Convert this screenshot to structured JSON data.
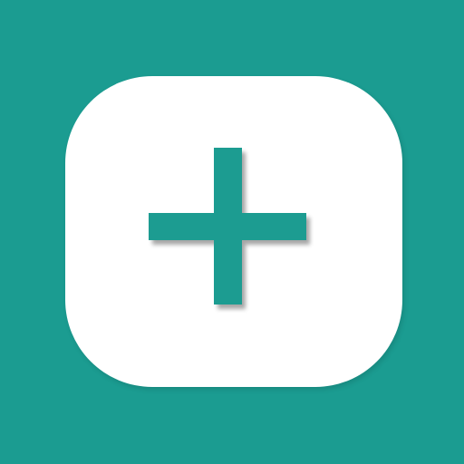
{
  "app": {
    "name": "add",
    "icon": "plus-icon"
  },
  "colors": {
    "background": "#1b9c91",
    "tile": "#ffffff",
    "accent": "#1b9c91"
  }
}
